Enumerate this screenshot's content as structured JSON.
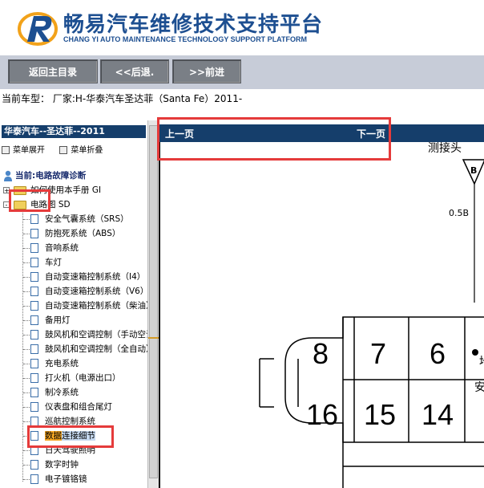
{
  "header": {
    "title": "畅易汽车维修技术支持平台",
    "subtitle": "CHANG YI AUTO MAINTENANCE TECHNOLOGY SUPPORT PLATFORM",
    "brand_color": "#1d4f91"
  },
  "toolbar": {
    "home_label": "返回主目录",
    "back_label": "<<后退.",
    "forward_label": ">>前进"
  },
  "model_line": "当前车型： 厂家:H-华泰汽车圣达菲（Santa Fe）2011-",
  "sidebar": {
    "title": "华泰汽车--圣达菲--2011",
    "expand_label": "菜单展开",
    "collapse_label": "菜单折叠",
    "current_label": "当前:电路故障诊断",
    "tree": [
      {
        "label": "如何使用本手册 GI",
        "type": "folder",
        "toggle": "+"
      },
      {
        "label": "电路图 SD",
        "type": "folder",
        "toggle": "-"
      },
      {
        "label": "安全气囊系统（SRS）",
        "type": "doc"
      },
      {
        "label": "防抱死系统（ABS）",
        "type": "doc"
      },
      {
        "label": "音响系统",
        "type": "doc"
      },
      {
        "label": "车灯",
        "type": "doc"
      },
      {
        "label": "自动变速箱控制系统（I4）",
        "type": "doc"
      },
      {
        "label": "自动变速箱控制系统（V6）",
        "type": "doc"
      },
      {
        "label": "自动变速箱控制系统（柴油）",
        "type": "doc"
      },
      {
        "label": "备用灯",
        "type": "doc"
      },
      {
        "label": "鼓风机和空调控制（手动空调）",
        "type": "doc"
      },
      {
        "label": "鼓风机和空调控制（全自动）",
        "type": "doc"
      },
      {
        "label": "充电系统",
        "type": "doc"
      },
      {
        "label": "打火机（电源出口）",
        "type": "doc"
      },
      {
        "label": "制冷系统",
        "type": "doc"
      },
      {
        "label": "仪表盘和组合尾灯",
        "type": "doc"
      },
      {
        "label": "巡航控制系统",
        "type": "doc"
      },
      {
        "label_part1": "数据",
        "label_part2": "连接细节",
        "type": "doc"
      },
      {
        "label": "日天驾驶照明",
        "type": "doc"
      },
      {
        "label": "数字时钟",
        "type": "doc"
      },
      {
        "label": "电子镀铬镜",
        "type": "doc"
      }
    ]
  },
  "main": {
    "prev_label": "上一页",
    "next_label": "下一页"
  },
  "diagram": {
    "top_text": "测接头",
    "connector_letter": "B",
    "wire_value": "0.5B",
    "pins_top": [
      "8",
      "7",
      "6"
    ],
    "pins_bottom": [
      "16",
      "15",
      "14"
    ],
    "side_text_1": "地",
    "side_text_2": "安"
  },
  "colors": {
    "nav_bar": "#153e6b",
    "toolbar_bg": "#c7ccd8",
    "button_bg": "#7a7f86",
    "highlight_box": "#e53b3b",
    "selected_text_bg": "#f5a623"
  }
}
